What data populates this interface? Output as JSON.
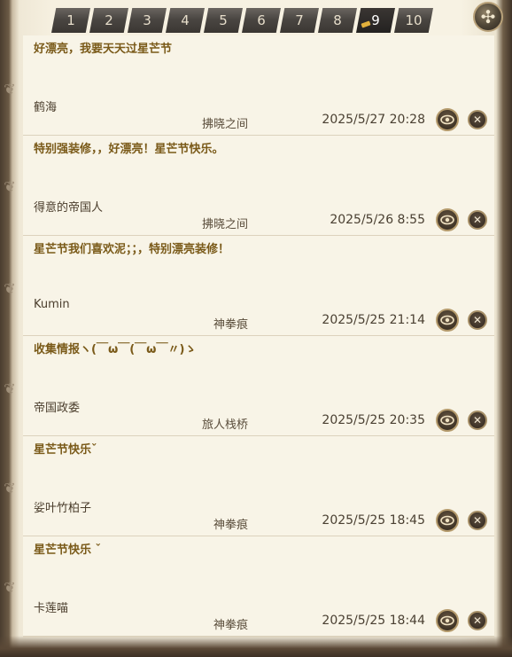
{
  "pagination": {
    "pages": [
      "1",
      "2",
      "3",
      "4",
      "5",
      "6",
      "7",
      "8",
      "9",
      "10"
    ],
    "current": "9"
  },
  "entries": [
    {
      "message": "好漂亮，我要天天过星芒节",
      "name": "鹤海",
      "world": "拂晓之间",
      "date": "2025/5/27 20:28"
    },
    {
      "message": "特别强装修，，好漂亮！星芒节快乐。",
      "name": "得意的帝国人",
      "world": "拂晓之间",
      "date": "2025/5/26 8:55"
    },
    {
      "message": "星芒节我们喜欢泥；；，特别漂亮装修！",
      "name": "Kumin",
      "world": "神拳痕",
      "date": "2025/5/25 21:14"
    },
    {
      "message": "收集情报ヽ(￣ω￣(￣ω￣〃)ゝ",
      "name": "帝国政委",
      "world": "旅人栈桥",
      "date": "2025/5/25 20:35"
    },
    {
      "message": "星芒节快乐ˇ",
      "name": "娑叶竹柏子",
      "world": "神拳痕",
      "date": "2025/5/25 18:45"
    },
    {
      "message": "星芒节快乐 ˇ",
      "name": "卡莲喵",
      "world": "神拳痕",
      "date": "2025/5/25 18:44"
    }
  ],
  "icons": {
    "corner": "settings-cross-icon",
    "view": "eye-icon",
    "delete": "close-icon"
  },
  "colors": {
    "message_text": "#7a5a19",
    "page_background": "#f8f4e7",
    "active_marker": "#e2b13c"
  }
}
